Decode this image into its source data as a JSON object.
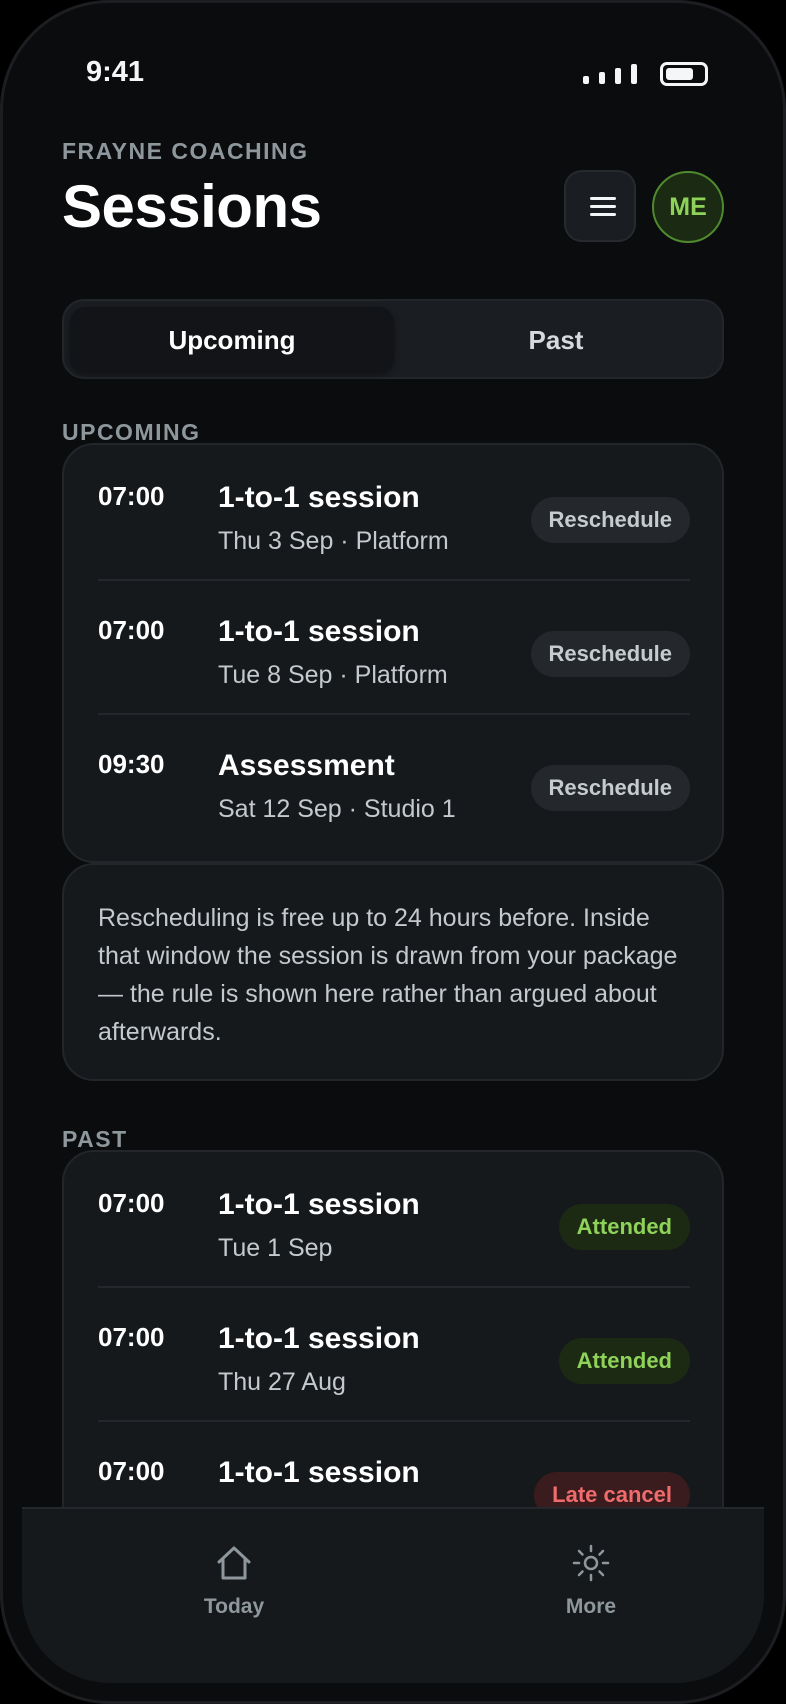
{
  "status_bar": {
    "time": "9:41"
  },
  "header": {
    "brand": "FRAYNE COACHING",
    "title": "Sessions",
    "avatar_initials": "ME"
  },
  "tabs": [
    {
      "label": "Upcoming",
      "active": true
    },
    {
      "label": "Past",
      "active": false
    }
  ],
  "upcoming": {
    "section_label": "UPCOMING",
    "sessions": [
      {
        "time": "07:00",
        "title": "1-to-1 session",
        "detail": "Thu 3 Sep · Platform",
        "action": "Reschedule"
      },
      {
        "time": "07:00",
        "title": "1-to-1 session",
        "detail": "Tue 8 Sep · Platform",
        "action": "Reschedule"
      },
      {
        "time": "09:30",
        "title": "Assessment",
        "detail": "Sat 12 Sep · Studio 1",
        "action": "Reschedule"
      }
    ],
    "policy_note": "Rescheduling is free up to 24 hours before. Inside that window the session is drawn from your package — the rule is shown here rather than argued about afterwards."
  },
  "past": {
    "section_label": "PAST",
    "sessions": [
      {
        "time": "07:00",
        "title": "1-to-1 session",
        "detail": "Tue 1 Sep",
        "status": "Attended"
      },
      {
        "time": "07:00",
        "title": "1-to-1 session",
        "detail": "Thu 27 Aug",
        "status": "Attended"
      },
      {
        "time": "07:00",
        "title": "1-to-1 session",
        "detail": "",
        "status": "Late cancel"
      }
    ]
  },
  "bottom_nav": [
    {
      "label": "Today",
      "icon": "home-icon"
    },
    {
      "label": "More",
      "icon": "sun-icon"
    }
  ],
  "colors": {
    "background": "#0b0c0e",
    "card": "#16191c",
    "accent_green": "#8fd259",
    "alert_red": "#f06b6b",
    "muted": "#8d979c"
  }
}
